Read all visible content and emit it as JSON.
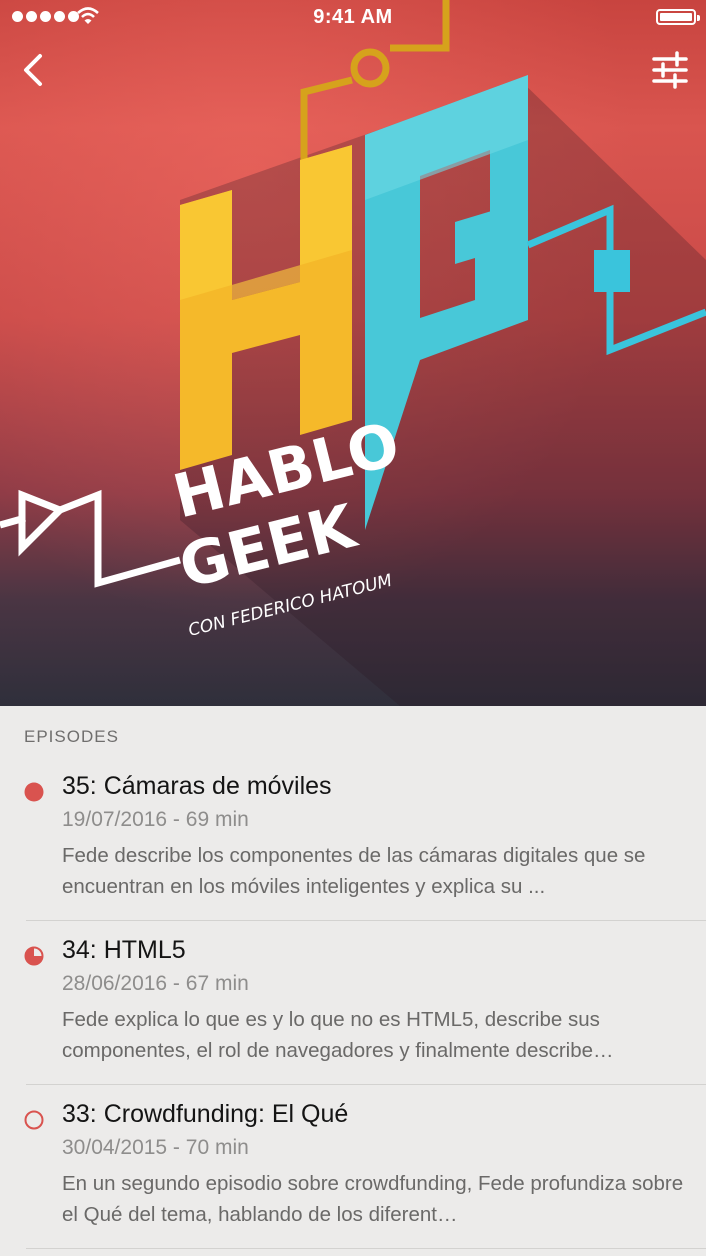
{
  "status_bar": {
    "time": "9:41 AM"
  },
  "nav": {
    "back_icon": "chevron-left-icon",
    "settings_icon": "sliders-icon"
  },
  "artwork": {
    "monogram": "HG",
    "line1": "HABLO",
    "line2": "GEEK",
    "byline": "CON FEDERICO HATOUM",
    "colors": {
      "h": "#f5b92a",
      "g": "#48c8d8",
      "wire_gold": "#d6a21c",
      "wire_blue": "#3ac4dc"
    }
  },
  "episodes_section": {
    "label": "EPISODES",
    "items": [
      {
        "title": "35: Cámaras de móviles",
        "meta": "19/07/2016 - 69 min",
        "description": "Fede describe los componentes de las cámaras digitales que se encuentran en los móviles inteligentes y explica su ...",
        "status": "unplayed",
        "status_icon": "filled-dot-icon"
      },
      {
        "title": "34: HTML5",
        "meta": "28/06/2016 - 67 min",
        "description": "Fede explica lo que es y lo que no es HTML5, describe sus componentes, el rol de navegadores y finalmente describe…",
        "status": "in-progress",
        "status_icon": "half-circle-icon"
      },
      {
        "title": "33: Crowdfunding: El Qué",
        "meta": "30/04/2015 - 70 min",
        "description": "En un segundo episodio sobre crowdfunding, Fede profundiza sobre el Qué del tema, hablando de los diferent…",
        "status": "played",
        "status_icon": "empty-circle-icon"
      }
    ]
  },
  "accent_color": "#d9534f"
}
